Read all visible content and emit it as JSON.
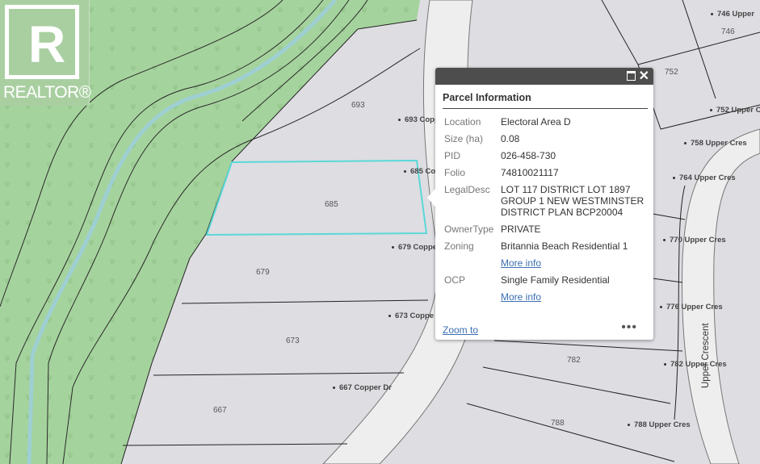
{
  "branding": {
    "logo_letter": "R",
    "logo_text": "REALTOR®"
  },
  "map": {
    "parcels": [
      {
        "id": "p693",
        "number": "693"
      },
      {
        "id": "p685",
        "number": "685"
      },
      {
        "id": "p679",
        "number": "679"
      },
      {
        "id": "p673",
        "number": "673"
      },
      {
        "id": "p667",
        "number": "667"
      },
      {
        "id": "p746",
        "number": "746"
      },
      {
        "id": "p752",
        "number": "752"
      },
      {
        "id": "p782",
        "number": "782"
      },
      {
        "id": "p788",
        "number": "788"
      }
    ],
    "addresses": [
      {
        "id": "a746",
        "text": "746 Upper"
      },
      {
        "id": "a693",
        "text": "693 Copp"
      },
      {
        "id": "a752",
        "text": "752 Upper C"
      },
      {
        "id": "a758",
        "text": "758 Upper Cres"
      },
      {
        "id": "a685",
        "text": "685 Co"
      },
      {
        "id": "a764",
        "text": "764 Upper Cres"
      },
      {
        "id": "a679",
        "text": "679 Coppe"
      },
      {
        "id": "a770",
        "text": "770 Upper Cres"
      },
      {
        "id": "a776",
        "text": "776 Upper Cres"
      },
      {
        "id": "a673",
        "text": "673 Coppe"
      },
      {
        "id": "a782",
        "text": "782 Upper Cres"
      },
      {
        "id": "a667",
        "text": "667 Copper Dr"
      },
      {
        "id": "a788",
        "text": "788 Upper Cres"
      }
    ],
    "street_label": "Upper Crescent",
    "colors": {
      "parkland": "#a5d39d",
      "parcel": "#dedde2",
      "road": "#eeeeee",
      "selected_outline": "#5ad8d8"
    }
  },
  "popup": {
    "title": "Parcel Information",
    "rows": [
      {
        "label": "Location",
        "value": "Electoral Area D"
      },
      {
        "label": "Size (ha)",
        "value": "0.08"
      },
      {
        "label": "PID",
        "value": "026-458-730"
      },
      {
        "label": "Folio",
        "value": "74810021117"
      },
      {
        "label": "LegalDesc",
        "value": "LOT 117 DISTRICT LOT 1897 GROUP 1 NEW WESTMINSTER DISTRICT PLAN BCP20004"
      },
      {
        "label": "OwnerType",
        "value": "PRIVATE"
      },
      {
        "label": "Zoning",
        "value": "Britannia Beach Residential 1"
      },
      {
        "label": "OCP",
        "value": "Single Family Residential"
      }
    ],
    "more_info": "More info",
    "zoom_to": "Zoom to",
    "menu": "•••"
  }
}
